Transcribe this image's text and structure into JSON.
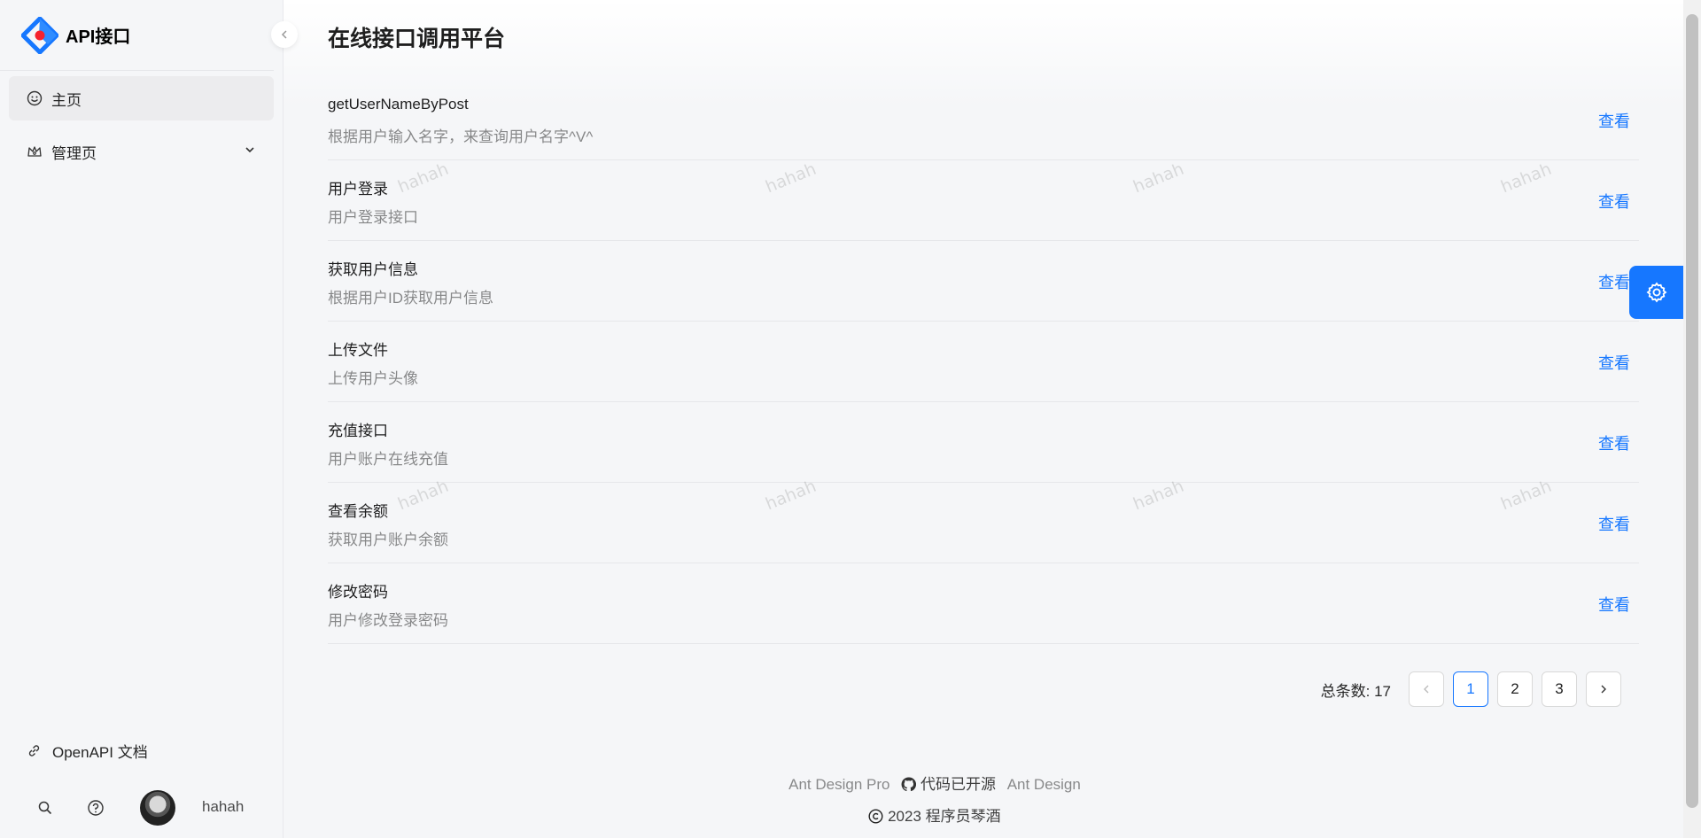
{
  "app": {
    "title": "API接口"
  },
  "sidebar": {
    "items": [
      {
        "label": "主页",
        "icon": "smile-icon"
      },
      {
        "label": "管理页",
        "icon": "crown-icon"
      }
    ],
    "openapi_label": "OpenAPI 文档",
    "username": "hahah"
  },
  "main": {
    "title": "在线接口调用平台",
    "items": [
      {
        "title": "getUserNameByPost",
        "desc": "根据用户输入名字，来查询用户名字^V^",
        "action": "查看"
      },
      {
        "title": "用户登录",
        "desc": "用户登录接口",
        "action": "查看"
      },
      {
        "title": "获取用户信息",
        "desc": "根据用户ID获取用户信息",
        "action": "查看"
      },
      {
        "title": "上传文件",
        "desc": "上传用户头像",
        "action": "查看"
      },
      {
        "title": "充值接口",
        "desc": "用户账户在线充值",
        "action": "查看"
      },
      {
        "title": "查看余额",
        "desc": "获取用户账户余额",
        "action": "查看"
      },
      {
        "title": "修改密码",
        "desc": "用户修改登录密码",
        "action": "查看"
      }
    ],
    "watermark": "hahah"
  },
  "pagination": {
    "total_label": "总条数: 17",
    "pages": [
      "1",
      "2",
      "3"
    ],
    "current": "1"
  },
  "footer": {
    "links": [
      "Ant Design Pro",
      "代码已开源",
      "Ant Design"
    ],
    "copyright": "2023 程序员琴酒"
  },
  "colors": {
    "primary": "#1677ff"
  }
}
